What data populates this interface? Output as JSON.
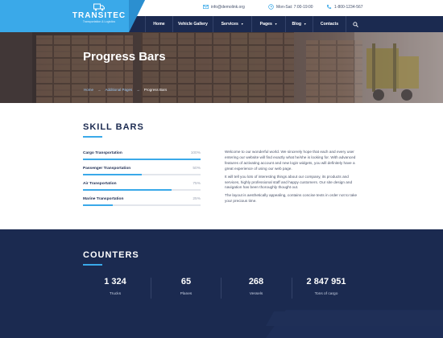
{
  "logo": {
    "title": "TRANSITEC",
    "subtitle": "Transportation & Logistics",
    "icon": "truck-icon"
  },
  "topbar": {
    "email": "info@demolink.org",
    "hours": "Mon-Sat: 7:00-19:00",
    "phone": "1-800-1234-567"
  },
  "nav": {
    "items": [
      {
        "label": "Home",
        "dropdown": false
      },
      {
        "label": "Vehicle Gallery",
        "dropdown": false
      },
      {
        "label": "Services",
        "dropdown": true
      },
      {
        "label": "Pages",
        "dropdown": true
      },
      {
        "label": "Blog",
        "dropdown": true
      },
      {
        "label": "Contacts",
        "dropdown": false
      }
    ],
    "search_icon": "search-icon"
  },
  "hero": {
    "title": "Progress Bars",
    "breadcrumb": [
      "Home",
      "Additional Pages",
      "Progress Bars"
    ],
    "separator": "→"
  },
  "skills": {
    "title": "SKILL BARS",
    "items": [
      {
        "label": "Cargo Transportation",
        "percent_text": "100%",
        "value": 100
      },
      {
        "label": "Passenger Transportation",
        "percent_text": "50%",
        "value": 50
      },
      {
        "label": "Air Transportation",
        "percent_text": "75%",
        "value": 75
      },
      {
        "label": "Marine Transportation",
        "percent_text": "25%",
        "value": 25
      }
    ]
  },
  "about": {
    "paragraphs": [
      "Welcome to our wonderful world. We sincerely hope that each and every user entering our website will find exactly what he/she is looking for. With advanced features of activating account and new login widgets, you will definitely have a great experience of using our web page.",
      "It will tell you lots of interesting things about our company, its products and services, highly professional staff and happy customers. Our site design and navigation has been thoroughly thought out.",
      "The layout is aesthetically appealing, contains concise texts in order not to take your precious time."
    ]
  },
  "counters": {
    "title": "COUNTERS",
    "items": [
      {
        "value": "1 324",
        "label": "Trucks"
      },
      {
        "value": "65",
        "label": "Planes"
      },
      {
        "value": "268",
        "label": "Vessels"
      },
      {
        "value": "2 847 951",
        "label": "Tons of cargo"
      }
    ]
  },
  "colors": {
    "navy": "#1b2a50",
    "accent": "#3aa9e9",
    "track": "#e3e6ec"
  }
}
